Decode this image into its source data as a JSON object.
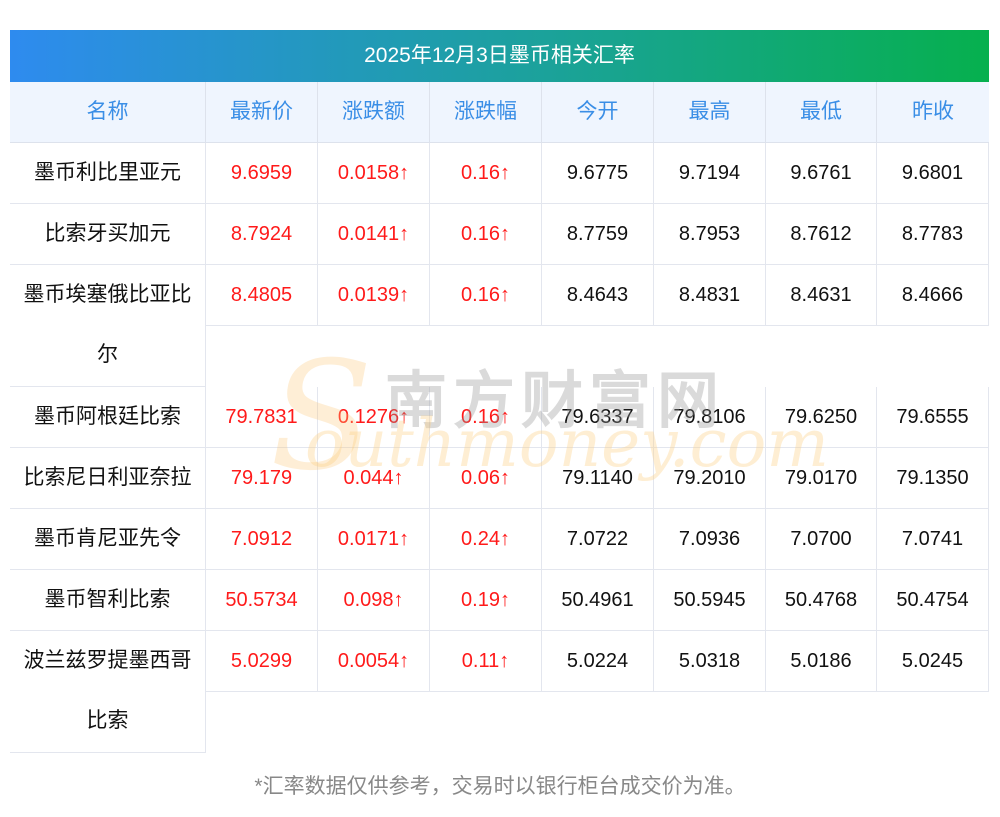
{
  "title": "2025年12月3日墨币相关汇率",
  "headers": [
    "名称",
    "最新价",
    "涨跌额",
    "涨跌幅",
    "今开",
    "最高",
    "最低",
    "昨收"
  ],
  "rows": [
    {
      "name": "墨币利比里亚元",
      "price": "9.6959",
      "change": "0.0158↑",
      "pct": "0.16↑",
      "open": "9.6775",
      "high": "9.7194",
      "low": "9.6761",
      "prev": "9.6801"
    },
    {
      "name": "比索牙买加元",
      "price": "8.7924",
      "change": "0.0141↑",
      "pct": "0.16↑",
      "open": "8.7759",
      "high": "8.7953",
      "low": "8.7612",
      "prev": "8.7783"
    },
    {
      "name": "墨币埃塞俄比亚比尔",
      "price": "8.4805",
      "change": "0.0139↑",
      "pct": "0.16↑",
      "open": "8.4643",
      "high": "8.4831",
      "low": "8.4631",
      "prev": "8.4666"
    },
    {
      "name": "墨币阿根廷比索",
      "price": "79.7831",
      "change": "0.1276↑",
      "pct": "0.16↑",
      "open": "79.6337",
      "high": "79.8106",
      "low": "79.6250",
      "prev": "79.6555"
    },
    {
      "name": "比索尼日利亚奈拉",
      "price": "79.179",
      "change": "0.044↑",
      "pct": "0.06↑",
      "open": "79.1140",
      "high": "79.2010",
      "low": "79.0170",
      "prev": "79.1350"
    },
    {
      "name": "墨币肯尼亚先令",
      "price": "7.0912",
      "change": "0.0171↑",
      "pct": "0.24↑",
      "open": "7.0722",
      "high": "7.0936",
      "low": "7.0700",
      "prev": "7.0741"
    },
    {
      "name": "墨币智利比索",
      "price": "50.5734",
      "change": "0.098↑",
      "pct": "0.19↑",
      "open": "50.4961",
      "high": "50.5945",
      "low": "50.4768",
      "prev": "50.4754"
    },
    {
      "name": "波兰兹罗提墨西哥比索",
      "price": "5.0299",
      "change": "0.0054↑",
      "pct": "0.11↑",
      "open": "5.0224",
      "high": "5.0318",
      "low": "5.0186",
      "prev": "5.0245"
    }
  ],
  "watermark": {
    "cn": "南方财富网",
    "en": "outhmoney.com",
    "s": "S"
  },
  "footnote": "*汇率数据仅供参考，交易时以银行柜台成交价为准。",
  "colors": {
    "up": "#ff1a1a",
    "header_text": "#3a8ee6"
  }
}
